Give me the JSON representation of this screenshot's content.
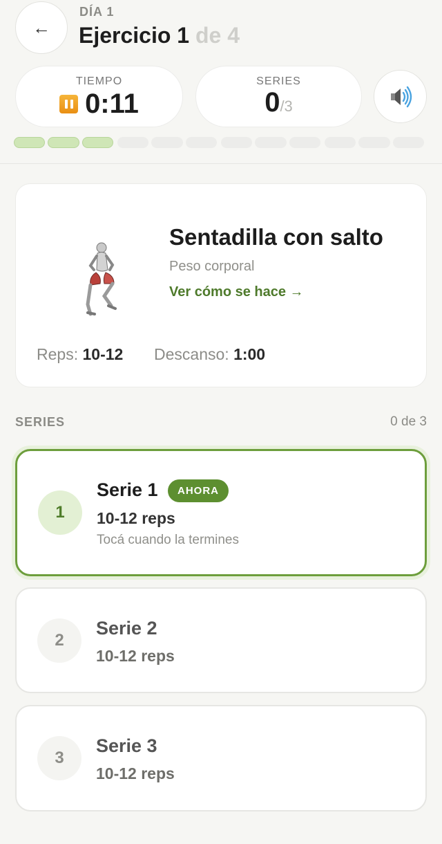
{
  "header": {
    "day_label": "DÍA 1",
    "exercise_label": "Ejercicio 1",
    "exercise_total": "de 4"
  },
  "stats": {
    "time_label": "TIEMPO",
    "time_value": "0:11",
    "series_label": "SERIES",
    "series_done": "0",
    "series_total": "/3"
  },
  "progress": {
    "completed_segments": 3,
    "total_segments": 12,
    "accent_color": "#cfe6b6"
  },
  "exercise": {
    "name": "Sentadilla con salto",
    "equipment": "Peso corporal",
    "how_link": "Ver cómo se hace →",
    "reps_label": "Reps:",
    "reps_value": "10-12",
    "rest_label": "Descanso:",
    "rest_value": "1:00"
  },
  "series_section": {
    "label": "SERIES",
    "count": "0 de 3",
    "sets": [
      {
        "number": "1",
        "title": "Serie 1",
        "badge": "AHORA",
        "reps": "10-12 reps",
        "hint": "Tocá cuando la termines"
      },
      {
        "number": "2",
        "title": "Serie 2",
        "reps": "10-12 reps"
      },
      {
        "number": "3",
        "title": "Serie 3",
        "reps": "10-12 reps"
      }
    ]
  },
  "icons": {
    "back": "back-arrow-icon",
    "pause": "pause-icon",
    "sound": "speaker-icon"
  },
  "colors": {
    "accent_green": "#5d8f30",
    "pause_orange": "#f0a228"
  }
}
